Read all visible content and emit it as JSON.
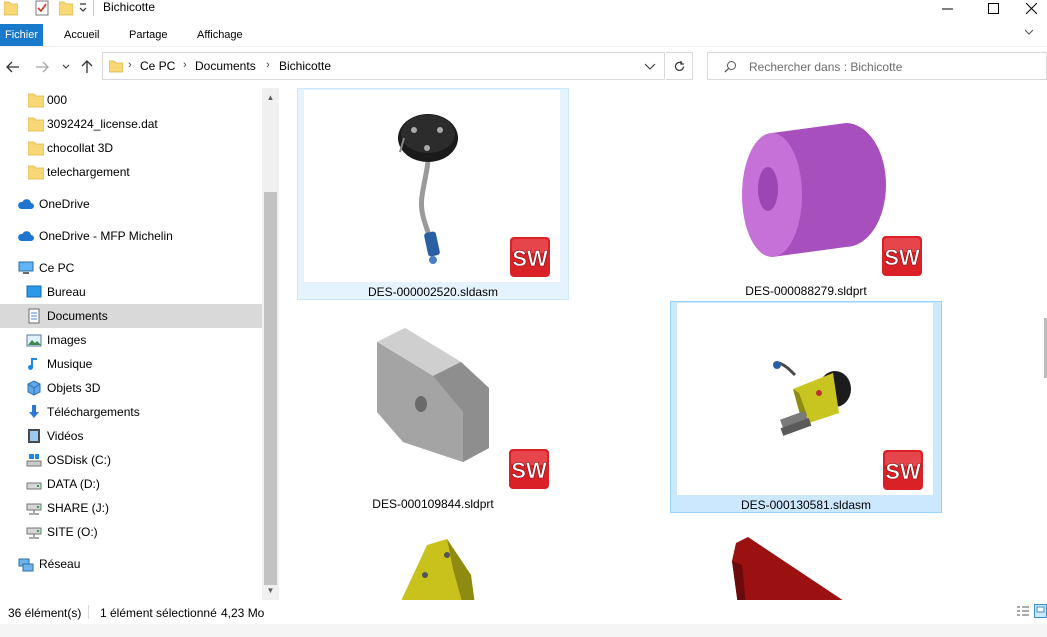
{
  "window": {
    "title": "Bichicotte"
  },
  "ribbon": {
    "tabs": [
      {
        "label": "Fichier"
      },
      {
        "label": "Accueil"
      },
      {
        "label": "Partage"
      },
      {
        "label": "Affichage"
      }
    ]
  },
  "address": {
    "crumbs": [
      "Ce PC",
      "Documents",
      "Bichicotte"
    ]
  },
  "search": {
    "placeholder": "Rechercher dans : Bichicotte"
  },
  "sidebar": {
    "items": [
      {
        "label": "000",
        "icon": "folder-icon"
      },
      {
        "label": "3092424_license.dat",
        "icon": "folder-icon"
      },
      {
        "label": "chocollat 3D",
        "icon": "folder-icon"
      },
      {
        "label": "telechargement",
        "icon": "folder-icon"
      },
      {
        "label": "OneDrive",
        "icon": "cloud-icon"
      },
      {
        "label": "OneDrive - MFP Michelin",
        "icon": "cloud-icon"
      },
      {
        "label": "Ce PC",
        "icon": "computer-icon"
      },
      {
        "label": "Bureau",
        "icon": "desktop-icon"
      },
      {
        "label": "Documents",
        "icon": "documents-icon"
      },
      {
        "label": "Images",
        "icon": "images-icon"
      },
      {
        "label": "Musique",
        "icon": "music-icon"
      },
      {
        "label": "Objets 3D",
        "icon": "3d-objects-icon"
      },
      {
        "label": "Téléchargements",
        "icon": "downloads-icon"
      },
      {
        "label": "Vidéos",
        "icon": "videos-icon"
      },
      {
        "label": "OSDisk (C:)",
        "icon": "drive-icon"
      },
      {
        "label": "DATA (D:)",
        "icon": "drive-icon"
      },
      {
        "label": "SHARE (J:)",
        "icon": "network-drive-icon"
      },
      {
        "label": "SITE (O:)",
        "icon": "network-drive-icon"
      },
      {
        "label": "Réseau",
        "icon": "network-icon"
      }
    ]
  },
  "files": [
    {
      "name": "DES-000002520.sldasm",
      "badge": "SW"
    },
    {
      "name": "DES-000088279.sldprt",
      "badge": "SW"
    },
    {
      "name": "DES-000109844.sldprt",
      "badge": "SW"
    },
    {
      "name": "DES-000130581.sldasm",
      "badge": "SW"
    }
  ],
  "status": {
    "count": "36 élément(s)",
    "selection": "1 élément sélectionné",
    "size": "4,23 Mo"
  },
  "colors": {
    "accent": "#1979ca",
    "selected_bg": "#cce8ff",
    "sw_red": "#da2127"
  }
}
